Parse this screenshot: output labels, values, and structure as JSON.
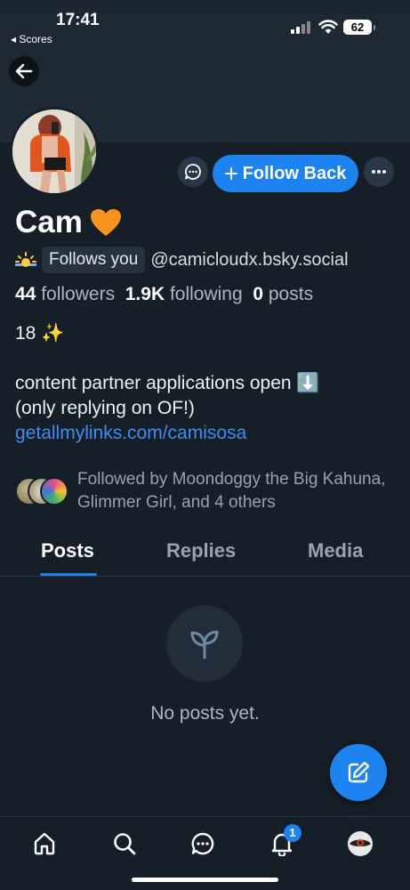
{
  "status_bar": {
    "time": "17:41",
    "back_app": "◂ Scores",
    "battery": "62"
  },
  "profile": {
    "display_name": "Cam",
    "name_emoji": "heart-orange-icon",
    "sun_emoji": "sunrise-icon",
    "follows_you": "Follows you",
    "handle": "@camicloudx.bsky.social",
    "followers_count": "44",
    "followers_label": "followers",
    "following_count": "1.9K",
    "following_label": "following",
    "posts_count": "0",
    "posts_label": "posts"
  },
  "bio": {
    "line1": "18 ✨",
    "line2": "content partner applications open ⬇️",
    "line3": "(only replying on OF!)",
    "link": "getallmylinks.com/camisosa"
  },
  "followed_by": {
    "text": "Followed by Moondoggy the Big Kahuna, Glimmer Girl, and 4 others"
  },
  "actions": {
    "follow_back": "Follow Back"
  },
  "tabs": [
    {
      "label": "Posts",
      "active": true
    },
    {
      "label": "Replies",
      "active": false
    },
    {
      "label": "Media",
      "active": false
    }
  ],
  "empty_state": {
    "text": "No posts yet."
  },
  "bottom_nav": {
    "notifications_badge": "1",
    "items": [
      "home-icon",
      "search-icon",
      "chat-icon",
      "bell-icon",
      "profile-avatar"
    ]
  },
  "colors": {
    "accent": "#1d83f0",
    "background": "#161e27",
    "link": "#3b8ff2"
  }
}
